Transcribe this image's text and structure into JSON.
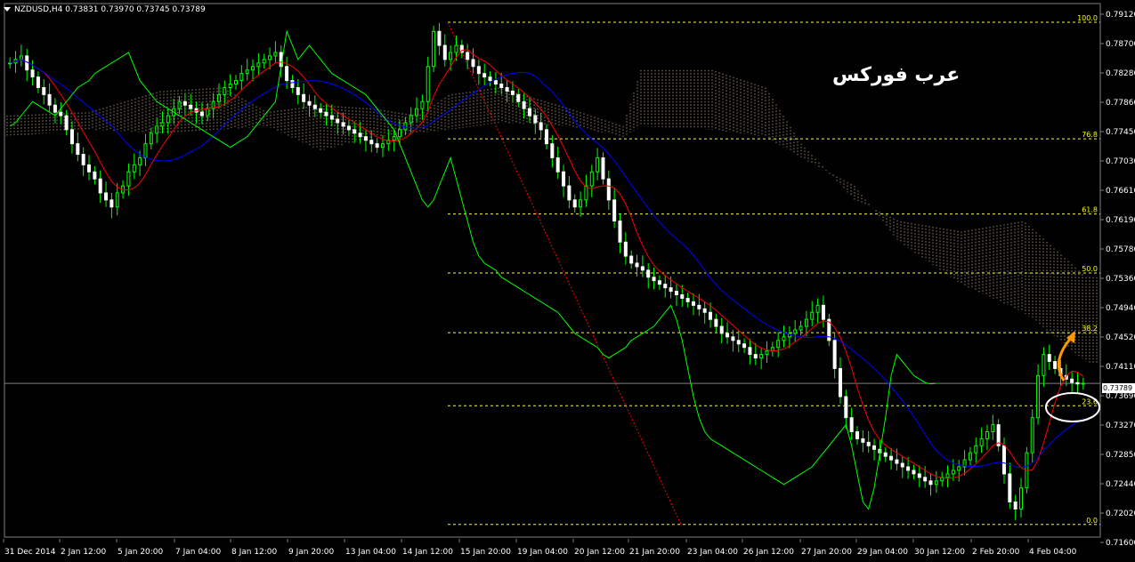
{
  "symbol_line": "NZDUSD,H4  0.73831 0.73970 0.73745 0.73789",
  "watermark": "عرب فوركس",
  "current_price_label": "0.73789",
  "colors": {
    "background": "#000000",
    "axis_text": "#ffffff",
    "bull_candle": "#00ff00",
    "bear_candle": "#ffffff",
    "tenkan": "#ff0000",
    "kijun": "#0000ff",
    "chikou": "#00ff00",
    "kumo": "#ffe0b0",
    "fibo": "#ffff00",
    "trend_line": "#ff0000",
    "arrow": "#ff9900",
    "ellipse": "#ffffff"
  },
  "chart_data": {
    "type": "candlestick",
    "title": "NZDUSD,H4",
    "indicators": [
      "Ichimoku Kinko Hyo",
      "Fibonacci retracement"
    ],
    "y_ticks": [
      "0.79120",
      "0.78700",
      "0.78280",
      "0.77860",
      "0.77450",
      "0.77030",
      "0.76610",
      "0.76190",
      "0.75780",
      "0.75360",
      "0.74940",
      "0.74520",
      "0.74110",
      "0.73690",
      "0.73270",
      "0.72850",
      "0.72440",
      "0.72020",
      "0.71600"
    ],
    "ylim": [
      0.716,
      0.7912
    ],
    "x_ticks": [
      "31 Dec 2014",
      "2 Jan 12:00",
      "5 Jan 20:00",
      "7 Jan 04:00",
      "8 Jan 12:00",
      "9 Jan 20:00",
      "13 Jan 04:00",
      "14 Jan 12:00",
      "15 Jan 20:00",
      "19 Jan 04:00",
      "20 Jan 12:00",
      "21 Jan 20:00",
      "23 Jan 04:00",
      "26 Jan 12:00",
      "27 Jan 20:00",
      "29 Jan 04:00",
      "30 Jan 12:00",
      "2 Feb 20:00",
      "4 Feb 04:00"
    ],
    "fib_levels": [
      {
        "label": "100.0",
        "price": 0.7893
      },
      {
        "label": "76.8",
        "price": 0.7727
      },
      {
        "label": "61.8",
        "price": 0.762
      },
      {
        "label": "50.0",
        "price": 0.7536
      },
      {
        "label": "38.2",
        "price": 0.7451
      },
      {
        "label": "23.6",
        "price": 0.7347
      },
      {
        "label": "0.0",
        "price": 0.7178
      }
    ],
    "current_price": 0.73789,
    "closes": [
      0.7835,
      0.784,
      0.7845,
      0.7825,
      0.7815,
      0.78,
      0.779,
      0.7775,
      0.7765,
      0.776,
      0.774,
      0.772,
      0.7705,
      0.769,
      0.768,
      0.767,
      0.765,
      0.764,
      0.763,
      0.765,
      0.766,
      0.768,
      0.769,
      0.77,
      0.772,
      0.7735,
      0.7745,
      0.775,
      0.776,
      0.777,
      0.778,
      0.7775,
      0.777,
      0.7765,
      0.776,
      0.777,
      0.778,
      0.779,
      0.78,
      0.7805,
      0.781,
      0.782,
      0.7825,
      0.783,
      0.7835,
      0.784,
      0.7845,
      0.785,
      0.783,
      0.781,
      0.78,
      0.779,
      0.778,
      0.7775,
      0.777,
      0.7765,
      0.776,
      0.7755,
      0.775,
      0.7745,
      0.774,
      0.7735,
      0.773,
      0.7725,
      0.772,
      0.7715,
      0.772,
      0.7725,
      0.773,
      0.774,
      0.775,
      0.776,
      0.777,
      0.778,
      0.783,
      0.788,
      0.786,
      0.784,
      0.785,
      0.786,
      0.785,
      0.784,
      0.783,
      0.782,
      0.7815,
      0.781,
      0.7805,
      0.78,
      0.7795,
      0.779,
      0.778,
      0.777,
      0.776,
      0.775,
      0.774,
      0.772,
      0.77,
      0.768,
      0.766,
      0.764,
      0.763,
      0.764,
      0.766,
      0.768,
      0.77,
      0.767,
      0.764,
      0.761,
      0.758,
      0.756,
      0.755,
      0.7545,
      0.754,
      0.753,
      0.7525,
      0.752,
      0.7515,
      0.751,
      0.7505,
      0.75,
      0.7495,
      0.749,
      0.7485,
      0.748,
      0.747,
      0.746,
      0.745,
      0.7445,
      0.744,
      0.7435,
      0.743,
      0.742,
      0.7415,
      0.742,
      0.7425,
      0.743,
      0.744,
      0.7445,
      0.745,
      0.7455,
      0.746,
      0.747,
      0.748,
      0.749,
      0.747,
      0.744,
      0.74,
      0.736,
      0.733,
      0.731,
      0.73,
      0.7295,
      0.729,
      0.7285,
      0.728,
      0.7275,
      0.727,
      0.7265,
      0.726,
      0.7255,
      0.725,
      0.7245,
      0.724,
      0.7235,
      0.724,
      0.7245,
      0.725,
      0.7255,
      0.726,
      0.727,
      0.728,
      0.729,
      0.73,
      0.731,
      0.732,
      0.729,
      0.725,
      0.721,
      0.72,
      0.723,
      0.728,
      0.733,
      0.739,
      0.742,
      0.741,
      0.74,
      0.739,
      0.7385,
      0.738,
      0.7378,
      0.7379
    ]
  }
}
